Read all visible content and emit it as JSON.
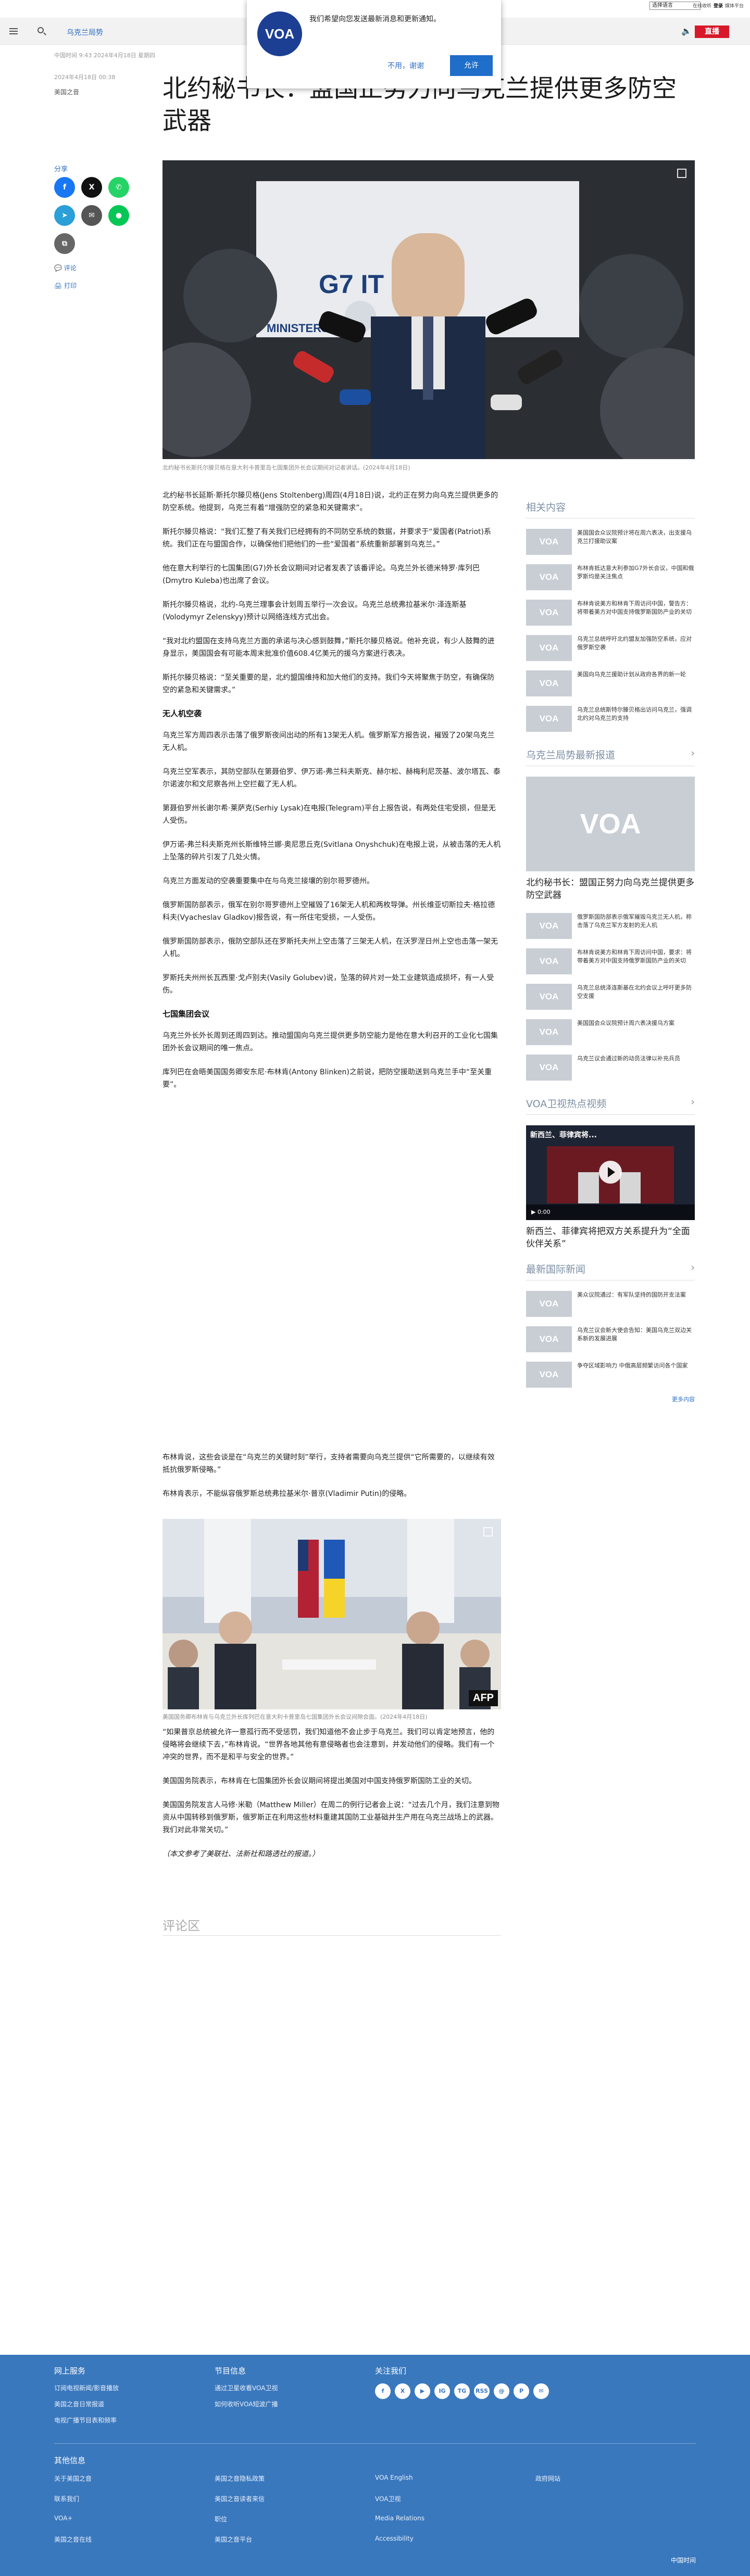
{
  "utility": {
    "language": "选择语言",
    "links": [
      "在线收听",
      "登录",
      "媒体平台"
    ]
  },
  "header": {
    "section": "乌克兰局势",
    "live_label": "直播"
  },
  "notification": {
    "message": "我们希望向您发送最新消息和更新通知。",
    "decline": "不用，谢谢",
    "accept": "允许"
  },
  "article": {
    "dateline": "中国时间 9:43 2024年4月18日 星期四",
    "date_published": "2024年4月18日 00:38",
    "byline": "美国之音",
    "headline": "北约秘书长：盟国正努力向乌克兰提供更多防空武器",
    "hero_caption": "北约秘书长斯托尔滕贝格在意大利卡普里岛七国集团外长会议期间对记者讲话。(2024年4月18日)",
    "paragraphs": [
      "北约秘书长延斯·斯托尔滕贝格(Jens Stoltenberg)周四(4月18日)说，北约正在努力向乌克兰提供更多的防空系统。他提到，乌克兰有着“增强防空的紧急和关键需求”。",
      "斯托尔滕贝格说：“我们汇整了有关我们已经拥有的不同防空系统的数据，并要求于“爱国者(Patriot)系统。我们正在与盟国合作，以确保他们把他们的一些“爱国者”系统重新部署到乌克兰。”",
      "他在意大利举行的七国集团(G7)外长会议期间对记者发表了该番评论。乌克兰外长德米特罗·库列巴(Dmytro Kuleba)也出席了会议。",
      "斯托尔滕贝格说，北约-乌克兰理事会计划周五举行一次会议。乌克兰总统弗拉基米尔·泽连斯基(Volodymyr Zelenskyy)预计以网络连线方式出会。",
      "“我对北约盟国在支持乌克兰方面的承诺与决心感到鼓舞，”斯托尔滕贝格说。他补充说，有少人鼓舞的进身显示，美国国会有可能本周末批准价值608.4亿美元的援乌方案进行表决。",
      "斯托尔滕贝格说：“至关重要的是，北约盟国维持和加大他们的支持。我们今天将聚焦于防空，有确保防空的紧急和关键需求。”"
    ],
    "section_heading_1": "无人机空袭",
    "paragraphs_2": [
      "乌克兰军方周四表示击落了俄罗斯夜间出动的所有13架无人机。俄罗斯军方报告说，摧毁了20架乌克兰无人机。",
      "乌克兰空军表示，其防空部队在第聂伯罗、伊万诺-弗兰科夫斯克、赫尔松、赫梅利尼茨基、波尔塔瓦、泰尔诺波尔和文尼察各州上空拦截了无人机。",
      "第聂伯罗州长谢尔希·莱萨克(Serhiy Lysak)在电报(Telegram)平台上报告说，有两处住宅受损，但是无人受伤。",
      "伊万诺-弗兰科夫斯克州长斯维特兰娜·奥尼思丘克(Svitlana Onyshchuk)在电报上说，从被击落的无人机上坠落的碎片引发了几处火情。",
      "乌克兰方面发动的空袭重要集中在与乌克兰接壤的别尔哥罗德州。",
      "俄罗斯国防部表示，俄军在别尔哥罗德州上空摧毁了16架无人机和两枚导弹。州长维亚切斯拉夫·格拉德科夫(Vyacheslav Gladkov)报告说，有一所住宅受损，一人受伤。",
      "俄罗斯国防部表示，俄防空部队还在罗斯托夫州上空击落了三架无人机，在沃罗涅日州上空也击落一架无人机。",
      "罗斯托夫州州长瓦西里·戈卢别夫(Vasily Golubev)说，坠落的碎片对一处工业建筑造成损坏，有一人受伤。"
    ],
    "section_heading_2": "七国集团会议",
    "paragraphs_3": [
      "乌克兰外长外长周到还周四到达。推动盟国向乌克兰提供更多防空能力是他在意大利召开的工业化七国集团外长会议期间的唯一焦点。",
      "库列巴在会晤美国国务卿安东尼·布林肯(Antony Blinken)之前说，把防空援助送到乌克兰手中“至关重要”。"
    ],
    "paragraphs_4": [
      "布林肯说，这些会谈是在“乌克兰的关键时刻”举行，支持者需要向乌克兰提供“它所需要的，以继续有效抵抗俄罗斯侵略。”",
      "布林肯表示，不能纵容俄罗斯总统弗拉基米尔·普京(Vladimir Putin)的侵略。"
    ],
    "photo2_caption": "美国国务卿布林肯与乌克兰外长库列巴在意大利卡普里岛七国集团外长会议间隙会面。(2024年4月18日)",
    "photo2_badge": "AFP",
    "paragraphs_5": [
      "“如果普京总统被允许一意孤行而不受惩罚，我们知道他不会止步于乌克兰。我们可以肯定地预言，他的侵略将会继续下去，”布林肯说。“世界各地其他有意侵略者也会注意到，并发动他们的侵略。我们有一个冲突的世界，而不是和平与安全的世界。”",
      "美国国务院表示，布林肯在七国集团外长会议期间将提出美国对中国支持俄罗斯国防工业的关切。",
      "美国国务院发言人马修·米勒（Matthew Miller）在周二的例行记者会上说：“过去几个月，我们注意到物资从中国转移到俄罗斯，俄罗斯正在利用这些材料重建其国防工业基础并生产用在乌克兰战场上的武器。我们对此非常关切。”",
      "（本文参考了美联社、法新社和路透社的报道。）"
    ],
    "comments_title": "评论区"
  },
  "share": {
    "label": "分享",
    "comment": "评论",
    "print": "打印"
  },
  "sidebar": {
    "related_title": "相关内容",
    "related": [
      "美国国会众议院预计将在周六表决，出支援乌克兰打援助议案",
      "布林肯抵达意大利参加G7外长会议，中国和俄罗斯均是关注焦点",
      "布林肯说美方和林肯下周访问中国，警告方：将带着美方对中国支持俄罗斯国防产业的关切",
      "乌克兰总统呼吁北约盟友加强防空系统，应对俄罗斯空袭",
      "美国向乌克兰援助计划从政府各界的新一轮",
      "乌克兰总统斯特尔滕贝格出访问乌克兰，强调北约对乌克兰的支持"
    ],
    "latest_title": "乌克兰局势最新报道",
    "latest_headline": "北约秘书长：盟国正努力向乌克兰提供更多防空武器",
    "latest": [
      "俄罗斯国防部表示俄军摧毁乌克兰无人机，称击落了乌克兰军方发射的无人机",
      "布林肯说美方和林肯下周访问中国，要求：将带着美方对中国支持俄罗斯国防产业的关切",
      "乌克兰总统泽连斯基在北约会议上呼吁更多防空支援",
      "美国国会众议院预计周六表决援乌方案",
      "乌克兰议会通过新的动员法律以补充兵员"
    ],
    "video_title": "VOA卫视热点视频",
    "video_label": "新西兰、菲律宾将...",
    "video_caption": "新西兰、菲律宾将把双方关系提升为“全面伙伴关系”",
    "video_time": "0:00",
    "intl_title": "最新国际新闻",
    "intl": [
      "美众议院通过：有军队坚持的国防开支法案",
      "乌克兰议会新大使会告知：美国乌克兰双边关系新的发展进展",
      "争夺区域影响力 中俄高层频繁访问各个国家"
    ],
    "more": "更多内容"
  },
  "footer": {
    "col1_title": "网上服务",
    "col1": [
      "订阅电视新闻/影音播放",
      "美国之音日常报道",
      "电视广播节目表和频率"
    ],
    "col2_title": "节目信息",
    "col2": [
      "通过卫星收看VOA卫视",
      "如何收听VOA短波广播"
    ],
    "col3_title": "关注我们",
    "social": [
      "f",
      "X",
      "▶",
      "IG",
      "TG",
      "RSS",
      "@",
      "P",
      "✉"
    ],
    "bottom_title": "其他信息",
    "bottom_links": [
      "关于美国之音",
      "美国之音隐私政策",
      "VOA English",
      "政府网站",
      "联系我们",
      "美国之音读者来信",
      "VOA卫视",
      "",
      "VOA+",
      "职位",
      "Media Relations",
      "",
      "美国之音在线",
      "美国之音平台",
      "Accessibility",
      ""
    ],
    "brand": "中国时间"
  },
  "colors": {
    "accent": "#2f6fc4",
    "live": "#d7182a",
    "footer": "#3a78bd"
  }
}
